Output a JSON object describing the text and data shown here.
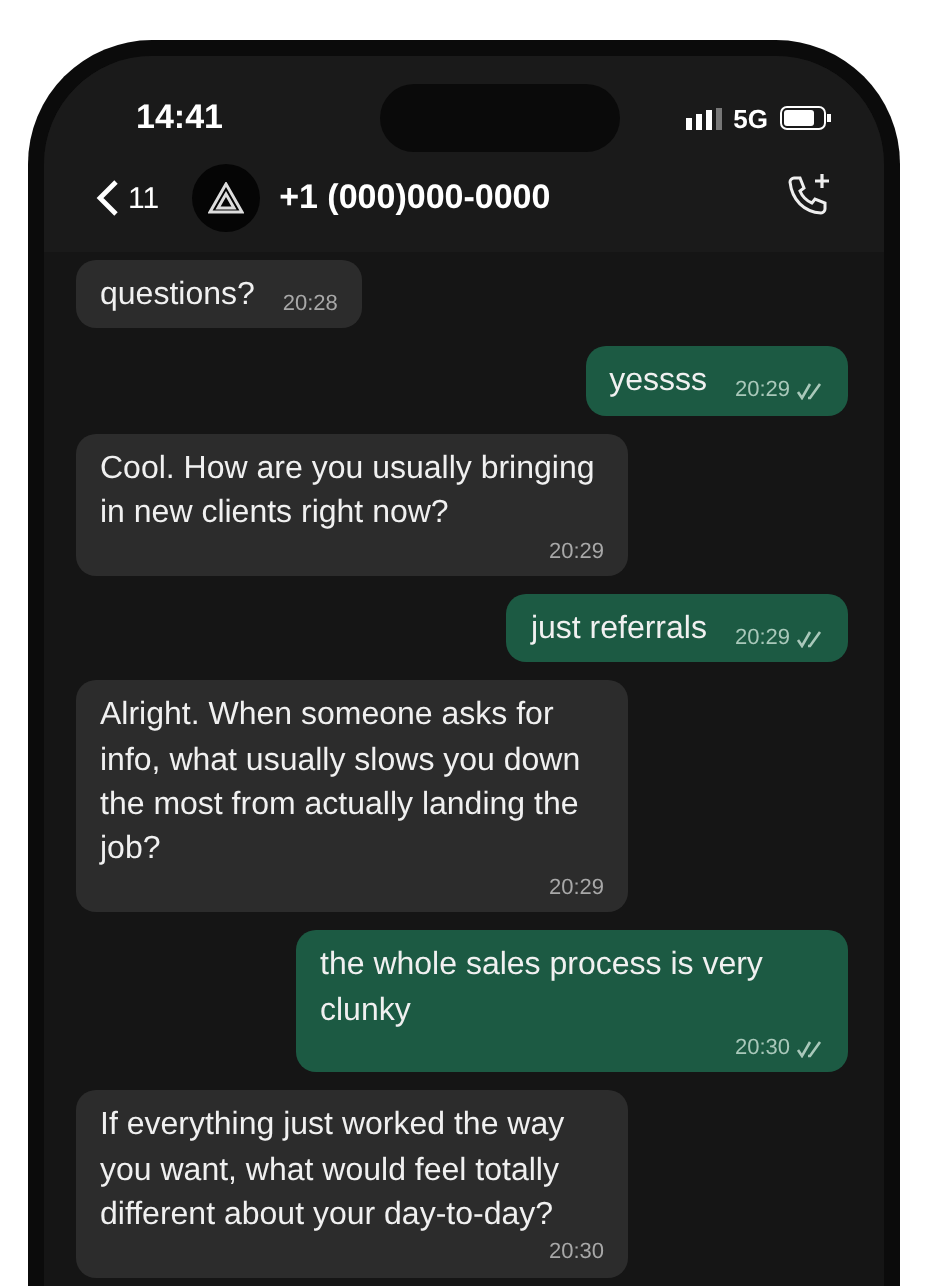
{
  "status_bar": {
    "time": "14:41",
    "network": "5G"
  },
  "header": {
    "back_count": "11",
    "contact": "+1 (000)000-0000"
  },
  "messages": [
    {
      "kind": "in",
      "text": "questions?",
      "time": "20:28"
    },
    {
      "kind": "out",
      "text": "yessss",
      "time": "20:29"
    },
    {
      "kind": "in",
      "text": "Cool. How are you usually bringing in new clients right now?",
      "time": "20:29"
    },
    {
      "kind": "out",
      "text": "just referrals",
      "time": "20:29"
    },
    {
      "kind": "in",
      "text": "Alright. When someone asks for info, what usually slows you down the most from actually landing the job?",
      "time": "20:29"
    },
    {
      "kind": "out",
      "text": "the whole sales process is very clunky",
      "time": "20:30"
    },
    {
      "kind": "in",
      "text": "If everything just worked the way you want, what would feel totally different about your day-to-day?",
      "time": "20:30"
    }
  ]
}
